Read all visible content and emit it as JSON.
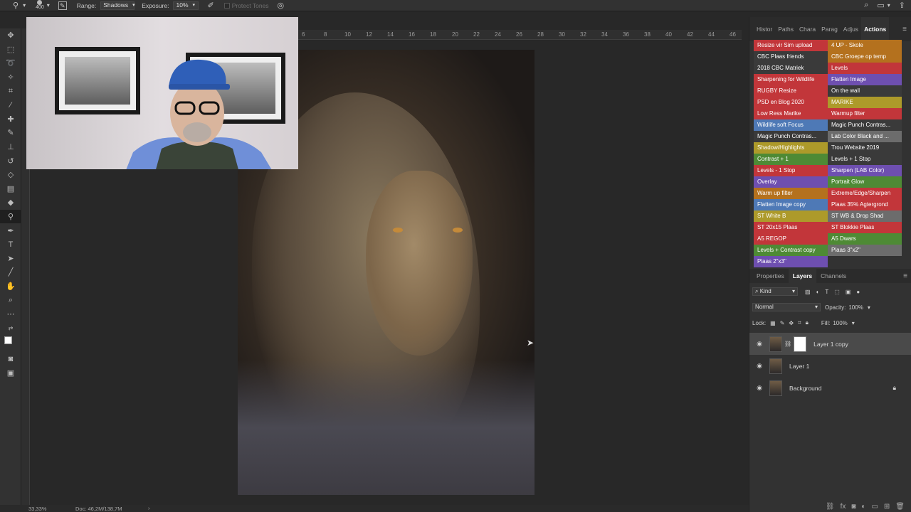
{
  "options_bar": {
    "brush_size": "400",
    "range_label": "Range:",
    "range_value": "Shadows",
    "exposure_label": "Exposure:",
    "exposure_value": "10%",
    "protect_tones": "Protect Tones"
  },
  "ruler": {
    "ticks": [
      "6",
      "8",
      "10",
      "12",
      "14",
      "16",
      "18",
      "20",
      "22",
      "24",
      "26",
      "28",
      "30",
      "32",
      "34",
      "36",
      "38",
      "40",
      "42",
      "44",
      "46"
    ]
  },
  "panel_tabs": [
    "Histor",
    "Paths",
    "Chara",
    "Parag",
    "Adjus",
    "Actions"
  ],
  "actions": [
    {
      "label": "Resize vir Sim upload",
      "color": "#c2363a"
    },
    {
      "label": "4 UP - Skole",
      "color": "#b4711e"
    },
    {
      "label": "CBC Plaas friends",
      "color": "#3a3a3a"
    },
    {
      "label": "CBC Groepe op temp",
      "color": "#b4711e"
    },
    {
      "label": "2018 CBC Matriek",
      "color": "#3a3a3a"
    },
    {
      "label": "Levels",
      "color": "#c2363a"
    },
    {
      "label": "Sharpening for Wildlife",
      "color": "#c2363a"
    },
    {
      "label": "Flatten Image",
      "color": "#6e4fb0"
    },
    {
      "label": "RUGBY Resize",
      "color": "#c2363a"
    },
    {
      "label": "On the wall",
      "color": "#3a3a3a"
    },
    {
      "label": "PSD en Blog 2020",
      "color": "#c2363a"
    },
    {
      "label": "MARIKE",
      "color": "#ad9a2a"
    },
    {
      "label": "Low Ress Marike",
      "color": "#c2363a"
    },
    {
      "label": "Warmup filter",
      "color": "#c2363a"
    },
    {
      "label": "Wildlife soft Focus",
      "color": "#4e79b6"
    },
    {
      "label": "Magic Punch Contras...",
      "color": "#3a3a3a"
    },
    {
      "label": "Magic Punch Contras...",
      "color": "#3a3a3a"
    },
    {
      "label": "Lab Color Black and ...",
      "color": "#6c6c6c"
    },
    {
      "label": "Shadow/Highlights",
      "color": "#ad9a2a"
    },
    {
      "label": "Trou Website 2019",
      "color": "#3a3a3a"
    },
    {
      "label": "Contrast + 1",
      "color": "#4e8a35"
    },
    {
      "label": "Levels + 1 Stop",
      "color": "#3a3a3a"
    },
    {
      "label": "Levels - 1 Stop",
      "color": "#c2363a"
    },
    {
      "label": "Sharpen (LAB Color)",
      "color": "#6e4fb0"
    },
    {
      "label": "Overlay",
      "color": "#6e4fb0"
    },
    {
      "label": "Portrait Glow",
      "color": "#4e8a35"
    },
    {
      "label": "Warm up filter",
      "color": "#b4711e"
    },
    {
      "label": "Extreme/Edge/Sharpen",
      "color": "#c2363a"
    },
    {
      "label": "Flatten Image copy",
      "color": "#4e79b6"
    },
    {
      "label": "Plaas 35% Agtergrond",
      "color": "#c2363a"
    },
    {
      "label": "ST White B",
      "color": "#ad9a2a"
    },
    {
      "label": "ST WB & Drop Shad",
      "color": "#6c6c6c"
    },
    {
      "label": "ST 20x15 Plaas",
      "color": "#c2363a"
    },
    {
      "label": "ST Blokkie Plaas",
      "color": "#c2363a"
    },
    {
      "label": "A5 REGOP",
      "color": "#c2363a"
    },
    {
      "label": "A5 Dwars",
      "color": "#4e8a35"
    },
    {
      "label": "Levels + Contrast copy",
      "color": "#4e8a35"
    },
    {
      "label": "Plaas 3\"x2\"",
      "color": "#6c6c6c"
    },
    {
      "label": "Plaas 2\"x3\"",
      "color": "#6e4fb0"
    }
  ],
  "layers_panel": {
    "tabs": [
      "Properties",
      "Layers",
      "Channels"
    ],
    "kind_label": "Kind",
    "blend_mode": "Normal",
    "opacity_label": "Opacity:",
    "opacity_value": "100%",
    "lock_label": "Lock:",
    "fill_label": "Fill:",
    "fill_value": "100%",
    "layers": [
      {
        "name": "Layer 1 copy",
        "selected": true
      },
      {
        "name": "Layer 1",
        "selected": false
      },
      {
        "name": "Background",
        "selected": false
      }
    ]
  },
  "status_bar": {
    "zoom": "33,33%",
    "doc": "Doc: 46,2M/138,7M"
  }
}
